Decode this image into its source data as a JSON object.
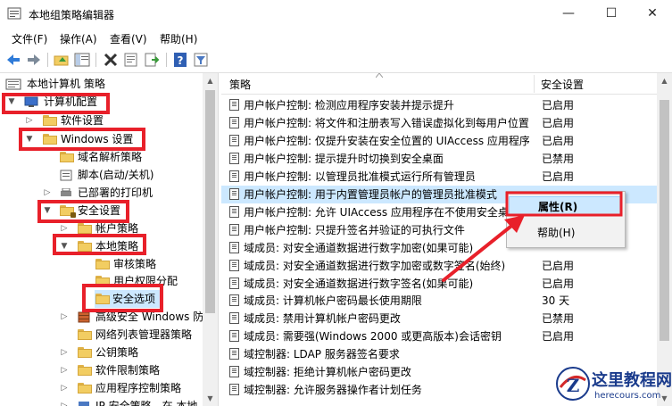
{
  "window": {
    "title": "本地组策略编辑器",
    "minimize_glyph": "—",
    "maximize_glyph": "☐",
    "close_glyph": "✕"
  },
  "menu": [
    {
      "id": "file",
      "label": "文件(F)"
    },
    {
      "id": "action",
      "label": "操作(A)"
    },
    {
      "id": "view",
      "label": "查看(V)"
    },
    {
      "id": "help",
      "label": "帮助(H)"
    }
  ],
  "toolbar": {
    "icons": [
      "back-arrow-icon",
      "forward-arrow-icon",
      "up-folder-icon",
      "show-hide-tree-icon",
      "delete-icon",
      "properties-icon",
      "export-list-icon",
      "help-icon",
      "filter-icon"
    ]
  },
  "tree": {
    "root": "本地计算机 策略",
    "computer_config": "计算机配置",
    "software_settings": "软件设置",
    "windows_settings": "Windows 设置",
    "name_resolution_policy": "域名解析策略",
    "scripts": "脚本(启动/关机)",
    "deployed_printers": "已部署的打印机",
    "security_settings": "安全设置",
    "account_policies": "帐户策略",
    "local_policies": "本地策略",
    "audit_policy": "审核策略",
    "user_rights": "用户权限分配",
    "security_options": "安全选项",
    "advanced_firewall": "高级安全 Windows 防",
    "network_list": "网络列表管理器策略",
    "public_key": "公钥策略",
    "software_restriction": "软件限制策略",
    "app_control": "应用程序控制策略",
    "ip_security": "IP 安全策略，在 本地"
  },
  "list": {
    "columns": {
      "policy": "策略",
      "setting": "安全设置"
    },
    "rows": [
      {
        "name": "用户帐户控制: 检测应用程序安装并提示提升",
        "value": "已启用"
      },
      {
        "name": "用户帐户控制: 将文件和注册表写入错误虚拟化到每用户位置",
        "value": "已启用"
      },
      {
        "name": "用户帐户控制: 仅提升安装在安全位置的 UIAccess 应用程序",
        "value": "已启用"
      },
      {
        "name": "用户帐户控制: 提示提升时切换到安全桌面",
        "value": "已禁用"
      },
      {
        "name": "用户帐户控制: 以管理员批准模式运行所有管理员",
        "value": "已启用"
      },
      {
        "name": "用户帐户控制: 用于内置管理员帐户的管理员批准模式",
        "value": "",
        "selected": true
      },
      {
        "name": "用户帐户控制: 允许 UIAccess 应用程序在不使用安全桌",
        "value": ""
      },
      {
        "name": "用户帐户控制: 只提升签名并验证的可执行文件",
        "value": ""
      },
      {
        "name": "域成员: 对安全通道数据进行数字加密(如果可能)",
        "value": ""
      },
      {
        "name": "域成员: 对安全通道数据进行数字加密或数字签名(始终)",
        "value": "已启用"
      },
      {
        "name": "域成员: 对安全通道数据进行数字签名(如果可能)",
        "value": "已启用"
      },
      {
        "name": "域成员: 计算机帐户密码最长使用期限",
        "value": "30 天"
      },
      {
        "name": "域成员: 禁用计算机帐户密码更改",
        "value": "已禁用"
      },
      {
        "name": "域成员: 需要强(Windows 2000 或更高版本)会话密钥",
        "value": "已启用"
      },
      {
        "name": "域控制器: LDAP 服务器签名要求",
        "value": ""
      },
      {
        "name": "域控制器: 拒绝计算机帐户密码更改",
        "value": ""
      },
      {
        "name": "域控制器: 允许服务器操作者计划任务",
        "value": ""
      }
    ]
  },
  "context_menu": {
    "properties": "属性(R)",
    "help": "帮助(H)"
  },
  "watermark": {
    "logo_letter": "Z",
    "title": "这里教程网",
    "url": "herecours.com"
  },
  "colors": {
    "highlight_box": "#e8202a",
    "selection": "#cce8ff",
    "watermark": "#1a3b8c"
  }
}
